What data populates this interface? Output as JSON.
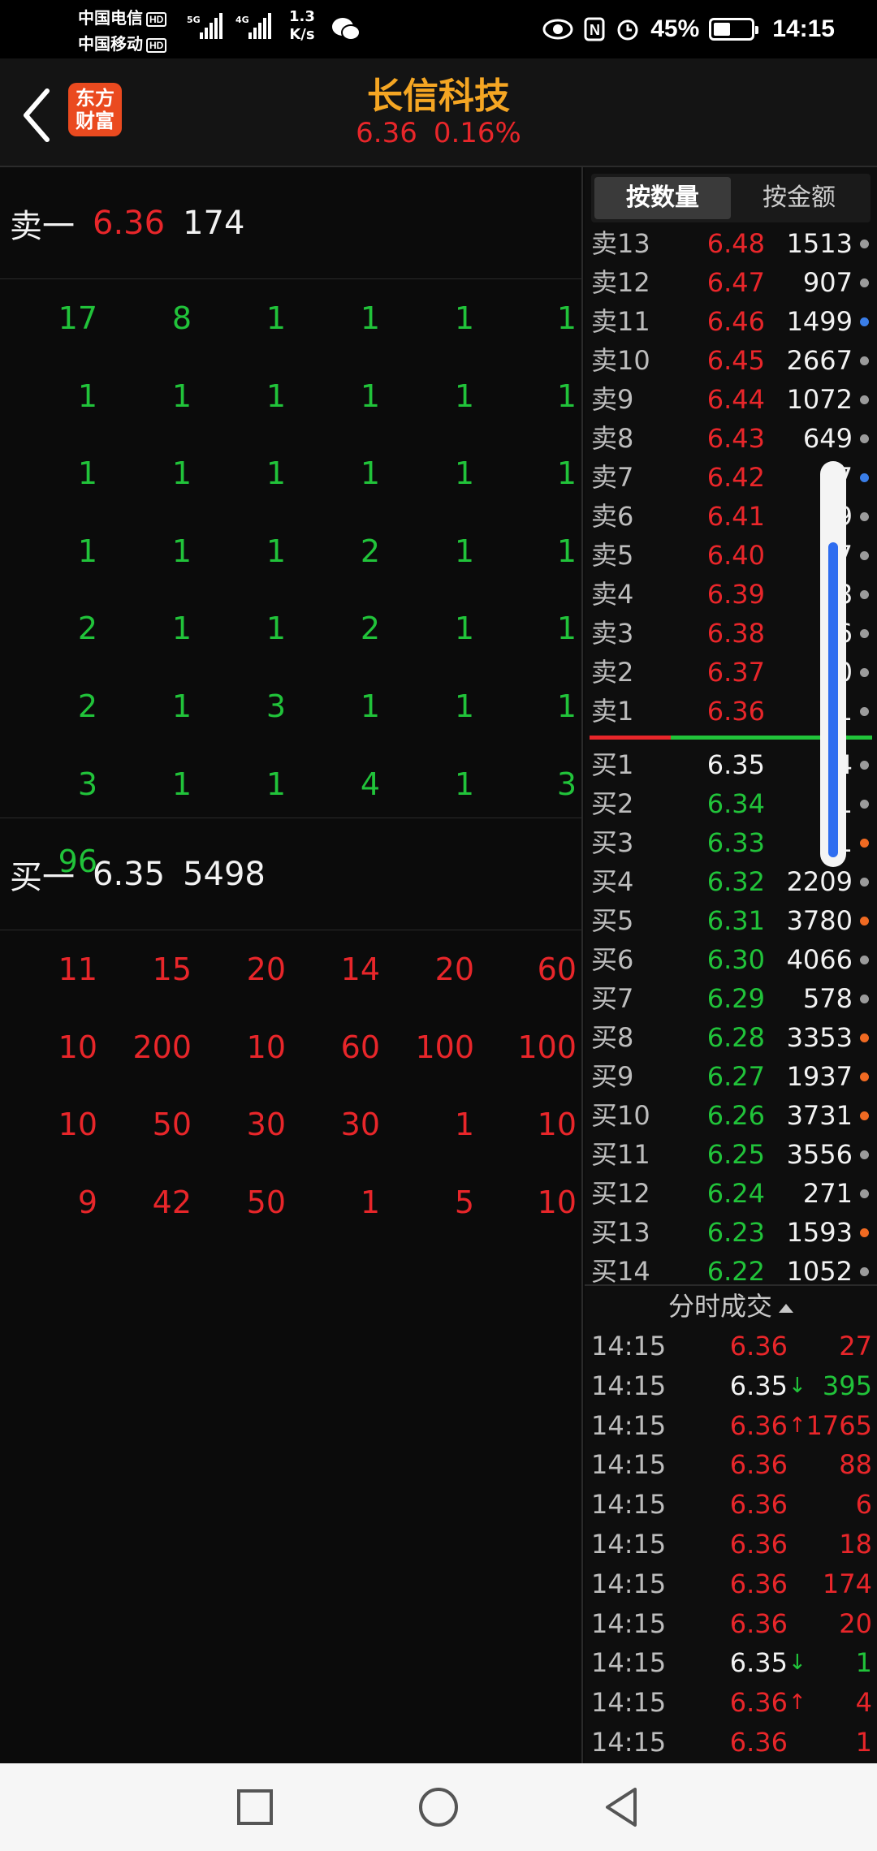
{
  "status_bar": {
    "carrier1": "中国电信",
    "carrier2": "中国移动",
    "hd": "HD",
    "net1": "5G",
    "net2": "4G",
    "speed_value": "1.3",
    "speed_unit": "K/s",
    "battery": "45%",
    "time": "14:15"
  },
  "header": {
    "logo_line1": "东方",
    "logo_line2": "财富",
    "stock_name": "长信科技",
    "price": "6.36",
    "change_pct": "0.16%"
  },
  "ask_queue": {
    "label": "卖一",
    "price": "6.36",
    "volume": "174",
    "rows": [
      [
        "17",
        "8",
        "1",
        "1",
        "1",
        "1"
      ],
      [
        "1",
        "1",
        "1",
        "1",
        "1",
        "1"
      ],
      [
        "1",
        "1",
        "1",
        "1",
        "1",
        "1"
      ],
      [
        "1",
        "1",
        "1",
        "2",
        "1",
        "1"
      ],
      [
        "2",
        "1",
        "1",
        "2",
        "1",
        "1"
      ],
      [
        "2",
        "1",
        "3",
        "1",
        "1",
        "1"
      ],
      [
        "3",
        "1",
        "1",
        "4",
        "1",
        "3"
      ],
      [
        "96"
      ]
    ]
  },
  "bid_queue": {
    "label": "买一",
    "price": "6.35",
    "volume": "5498",
    "rows": [
      [
        "11",
        "15",
        "20",
        "14",
        "20",
        "60"
      ],
      [
        "10",
        "200",
        "10",
        "60",
        "100",
        "100"
      ],
      [
        "10",
        "50",
        "30",
        "30",
        "1",
        "10"
      ],
      [
        "9",
        "42",
        "50",
        "1",
        "5",
        "10"
      ]
    ]
  },
  "toggle": {
    "by_quantity": "按数量",
    "by_amount": "按金额",
    "active": "by_quantity"
  },
  "depth": {
    "asks": [
      {
        "label": "卖13",
        "price": "6.48",
        "volume": "1513",
        "dot": "grey"
      },
      {
        "label": "卖12",
        "price": "6.47",
        "volume": "907",
        "dot": "grey"
      },
      {
        "label": "卖11",
        "price": "6.46",
        "volume": "1499",
        "dot": "blue"
      },
      {
        "label": "卖10",
        "price": "6.45",
        "volume": "2667",
        "dot": "grey"
      },
      {
        "label": "卖9",
        "price": "6.44",
        "volume": "1072",
        "dot": "grey"
      },
      {
        "label": "卖8",
        "price": "6.43",
        "volume": "649",
        "dot": "grey"
      },
      {
        "label": "卖7",
        "price": "6.42",
        "volume": "17",
        "dot": "blue"
      },
      {
        "label": "卖6",
        "price": "6.41",
        "volume": "9",
        "dot": "grey"
      },
      {
        "label": "卖5",
        "price": "6.40",
        "volume": "37",
        "dot": "grey"
      },
      {
        "label": "卖4",
        "price": "6.39",
        "volume": "8",
        "dot": "grey"
      },
      {
        "label": "卖3",
        "price": "6.38",
        "volume": "6",
        "dot": "grey"
      },
      {
        "label": "卖2",
        "price": "6.37",
        "volume": "10",
        "dot": "grey"
      },
      {
        "label": "卖1",
        "price": "6.36",
        "volume": "1",
        "dot": "grey"
      }
    ],
    "bids": [
      {
        "label": "买1",
        "price": "6.35",
        "price_color": "white",
        "volume": "54",
        "dot": "grey"
      },
      {
        "label": "买2",
        "price": "6.34",
        "price_color": "green",
        "volume": "21",
        "dot": "grey"
      },
      {
        "label": "买3",
        "price": "6.33",
        "price_color": "green",
        "volume": "31",
        "dot": "orange"
      },
      {
        "label": "买4",
        "price": "6.32",
        "price_color": "green",
        "volume": "2209",
        "dot": "grey"
      },
      {
        "label": "买5",
        "price": "6.31",
        "price_color": "green",
        "volume": "3780",
        "dot": "orange"
      },
      {
        "label": "买6",
        "price": "6.30",
        "price_color": "green",
        "volume": "4066",
        "dot": "grey"
      },
      {
        "label": "买7",
        "price": "6.29",
        "price_color": "green",
        "volume": "578",
        "dot": "grey"
      },
      {
        "label": "买8",
        "price": "6.28",
        "price_color": "green",
        "volume": "3353",
        "dot": "orange"
      },
      {
        "label": "买9",
        "price": "6.27",
        "price_color": "green",
        "volume": "1937",
        "dot": "orange"
      },
      {
        "label": "买10",
        "price": "6.26",
        "price_color": "green",
        "volume": "3731",
        "dot": "orange"
      },
      {
        "label": "买11",
        "price": "6.25",
        "price_color": "green",
        "volume": "3556",
        "dot": "grey"
      },
      {
        "label": "买12",
        "price": "6.24",
        "price_color": "green",
        "volume": "271",
        "dot": "grey"
      },
      {
        "label": "买13",
        "price": "6.23",
        "price_color": "green",
        "volume": "1593",
        "dot": "orange"
      },
      {
        "label": "买14",
        "price": "6.22",
        "price_color": "green",
        "volume": "1052",
        "dot": "grey"
      }
    ]
  },
  "ticks": {
    "title": "分时成交",
    "rows": [
      {
        "time": "14:15",
        "price": "6.36",
        "price_color": "red",
        "arrow": "",
        "volume": "27",
        "vol_color": "red"
      },
      {
        "time": "14:15",
        "price": "6.35",
        "price_color": "white",
        "arrow": "↓",
        "arrow_color": "green",
        "volume": "395",
        "vol_color": "green"
      },
      {
        "time": "14:15",
        "price": "6.36",
        "price_color": "red",
        "arrow": "↑",
        "arrow_color": "red",
        "volume": "1765",
        "vol_color": "red"
      },
      {
        "time": "14:15",
        "price": "6.36",
        "price_color": "red",
        "arrow": "",
        "volume": "88",
        "vol_color": "red"
      },
      {
        "time": "14:15",
        "price": "6.36",
        "price_color": "red",
        "arrow": "",
        "volume": "6",
        "vol_color": "red"
      },
      {
        "time": "14:15",
        "price": "6.36",
        "price_color": "red",
        "arrow": "",
        "volume": "18",
        "vol_color": "red"
      },
      {
        "time": "14:15",
        "price": "6.36",
        "price_color": "red",
        "arrow": "",
        "volume": "174",
        "vol_color": "red"
      },
      {
        "time": "14:15",
        "price": "6.36",
        "price_color": "red",
        "arrow": "",
        "volume": "20",
        "vol_color": "red"
      },
      {
        "time": "14:15",
        "price": "6.35",
        "price_color": "white",
        "arrow": "↓",
        "arrow_color": "green",
        "volume": "1",
        "vol_color": "green"
      },
      {
        "time": "14:15",
        "price": "6.36",
        "price_color": "red",
        "arrow": "↑",
        "arrow_color": "red",
        "volume": "4",
        "vol_color": "red"
      },
      {
        "time": "14:15",
        "price": "6.36",
        "price_color": "red",
        "arrow": "",
        "volume": "1",
        "vol_color": "red"
      }
    ]
  },
  "nav": {
    "recent_icon": "square-icon",
    "home_icon": "circle-icon",
    "back_icon": "triangle-back-icon"
  }
}
